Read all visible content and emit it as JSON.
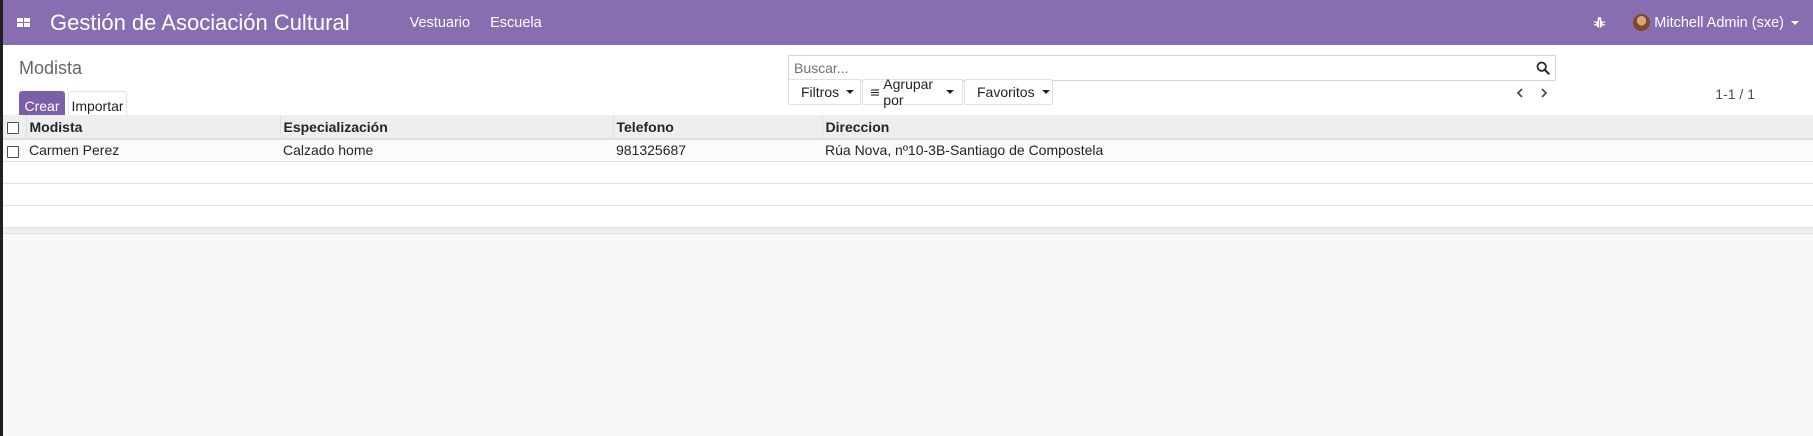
{
  "navbar": {
    "brand": "Gestión de Asociación Cultural",
    "menu": [
      "Vestuario",
      "Escuela"
    ],
    "user": "Mitchell Admin (sxe)",
    "bg_color": "#876eb1"
  },
  "control_panel": {
    "breadcrumb": "Modista",
    "create_label": "Crear",
    "import_label": "Importar",
    "search_placeholder": "Buscar...",
    "filters_label": "Filtros",
    "groupby_label": "Agrupar por",
    "favorites_label": "Favoritos",
    "pager": "1-1 / 1"
  },
  "table": {
    "columns": [
      "Modista",
      "Especialización",
      "Telefono",
      "Direccion"
    ],
    "rows": [
      [
        "Carmen Perez",
        "Calzado home",
        "981325687",
        "Rúa Nova, nº10-3B-Santiago de Compostela"
      ]
    ]
  },
  "accent_color": "#7c5fa8"
}
